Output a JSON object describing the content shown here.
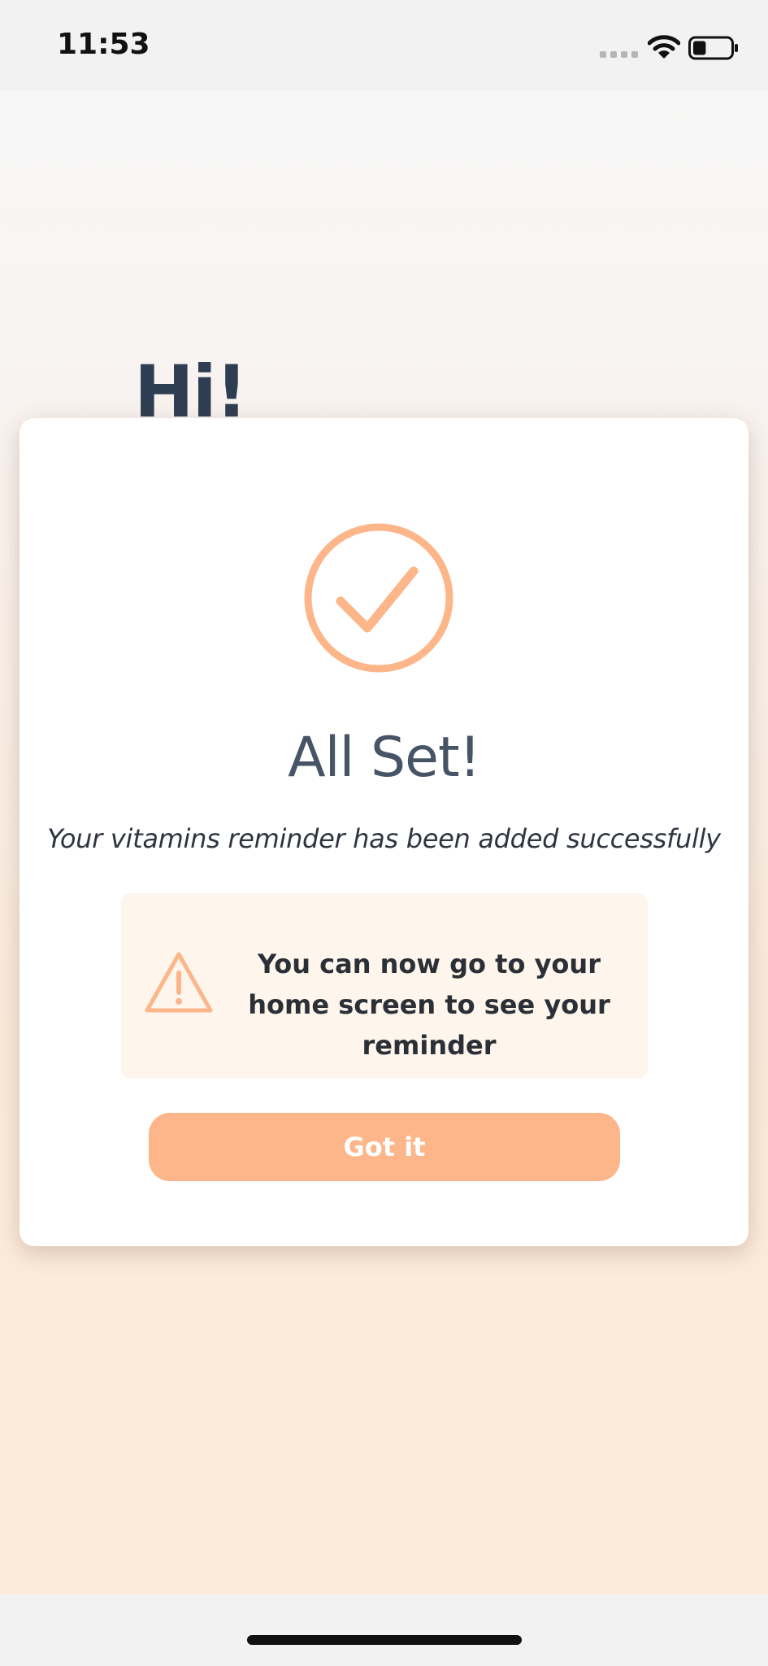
{
  "status_bar": {
    "time": "11:53",
    "signal_icon": "signal-dots-icon",
    "wifi_icon": "wifi-icon",
    "battery_icon": "battery-icon",
    "battery_level": 0.35
  },
  "screen": {
    "greeting": "Hi!"
  },
  "modal": {
    "icon": "check-circle-icon",
    "title": "All Set!",
    "subtitle": "Your vitamins reminder has been added successfully",
    "notice": {
      "icon": "warning-icon",
      "text": "You can now go to your home screen to see your reminder"
    },
    "button_label": "Got it"
  },
  "colors": {
    "accent": "#fcb68a",
    "title_text": "#475466",
    "greeting_text": "#2f3d52",
    "notice_bg": "#fef5ec"
  }
}
